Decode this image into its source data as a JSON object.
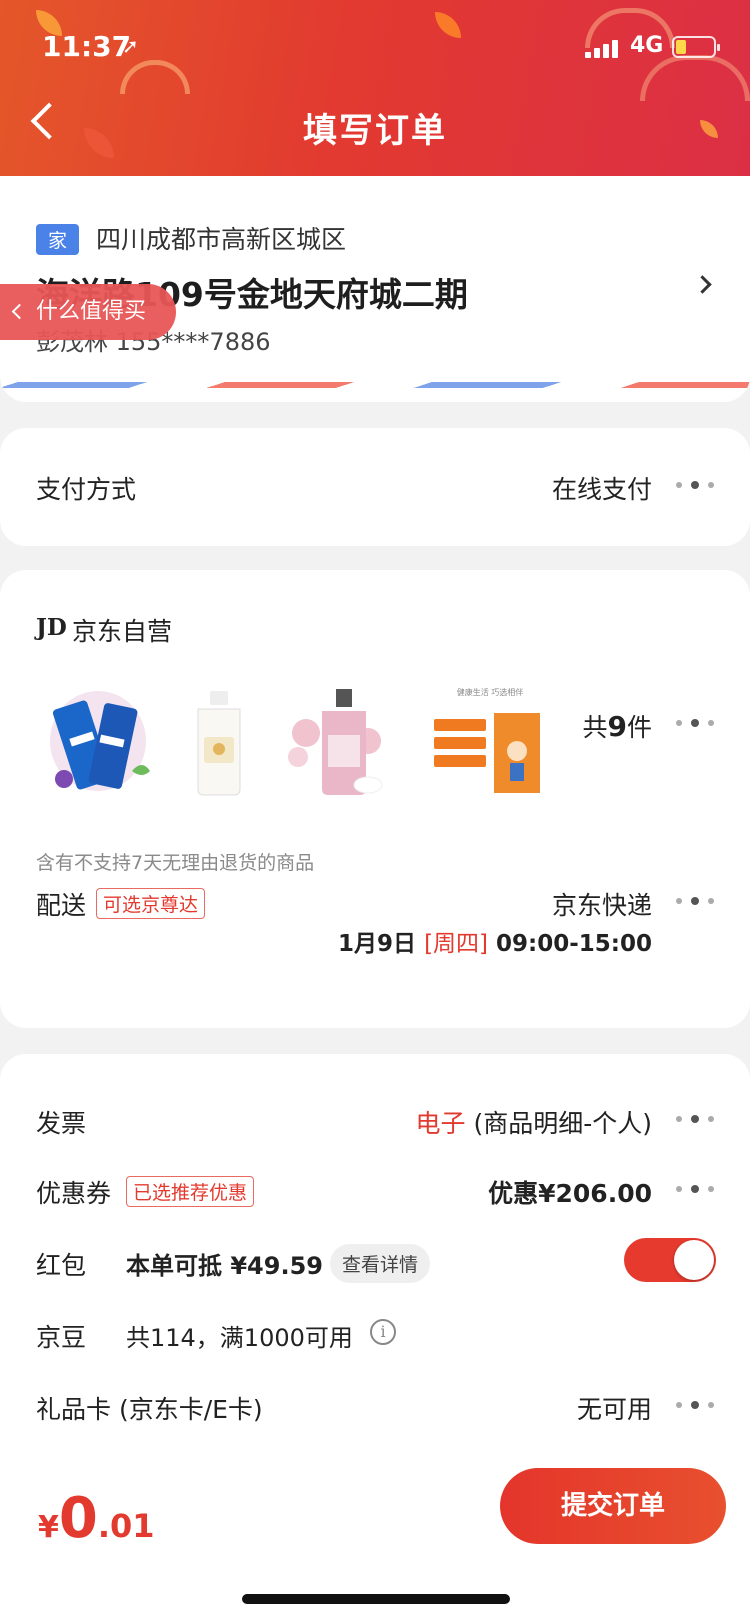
{
  "status_bar": {
    "time": "11:37",
    "network": "4G"
  },
  "header": {
    "title": "填写订单"
  },
  "address": {
    "tag": "家",
    "region": "四川成都市高新区城区",
    "street": "海洋路109号金地天府城二期",
    "contact": "彭茂林  155****7886"
  },
  "floating_button": {
    "label": "什么值得买"
  },
  "payment": {
    "label": "支付方式",
    "value": "在线支付"
  },
  "shop": {
    "logo": "JD",
    "name": "京东自营",
    "products": [
      {
        "name": "toothpaste",
        "color": "#1a66c9"
      },
      {
        "name": "mouthwash",
        "color": "#f2e7c6"
      },
      {
        "name": "shower-gel",
        "color": "#e9b7c8"
      },
      {
        "name": "health-book",
        "color": "#f07a1f"
      }
    ],
    "product_card_text": "健康生活 巧选相伴",
    "count_prefix": "共",
    "count": "9",
    "count_suffix": "件",
    "note": "含有不支持7天无理由退货的商品"
  },
  "delivery": {
    "label": "配送",
    "tag": "可选京尊达",
    "carrier": "京东快递",
    "date": "1月9日",
    "weekday": "[周四]",
    "time": "09:00-15:00"
  },
  "invoice": {
    "label": "发票",
    "type": "电子",
    "detail": "(商品明细-个人)"
  },
  "coupon": {
    "label": "优惠券",
    "tag": "已选推荐优惠",
    "value": "优惠¥206.00"
  },
  "red_packet": {
    "label": "红包",
    "text": "本单可抵 ¥49.59",
    "detail_button": "查看详情",
    "enabled": true
  },
  "jd_beans": {
    "label": "京豆",
    "text": "共114，满1000可用",
    "icon": "info-icon"
  },
  "gift_card": {
    "label": "礼品卡 (京东卡/E卡)",
    "value": "无可用"
  },
  "bottom_bar": {
    "currency": "¥",
    "price_int": "0",
    "price_dec": ".01",
    "submit_label": "提交订单"
  },
  "colors": {
    "accent": "#e33a2f",
    "header_start": "#e4572a",
    "header_end": "#dc2f45",
    "home_tag": "#4a82e8"
  }
}
